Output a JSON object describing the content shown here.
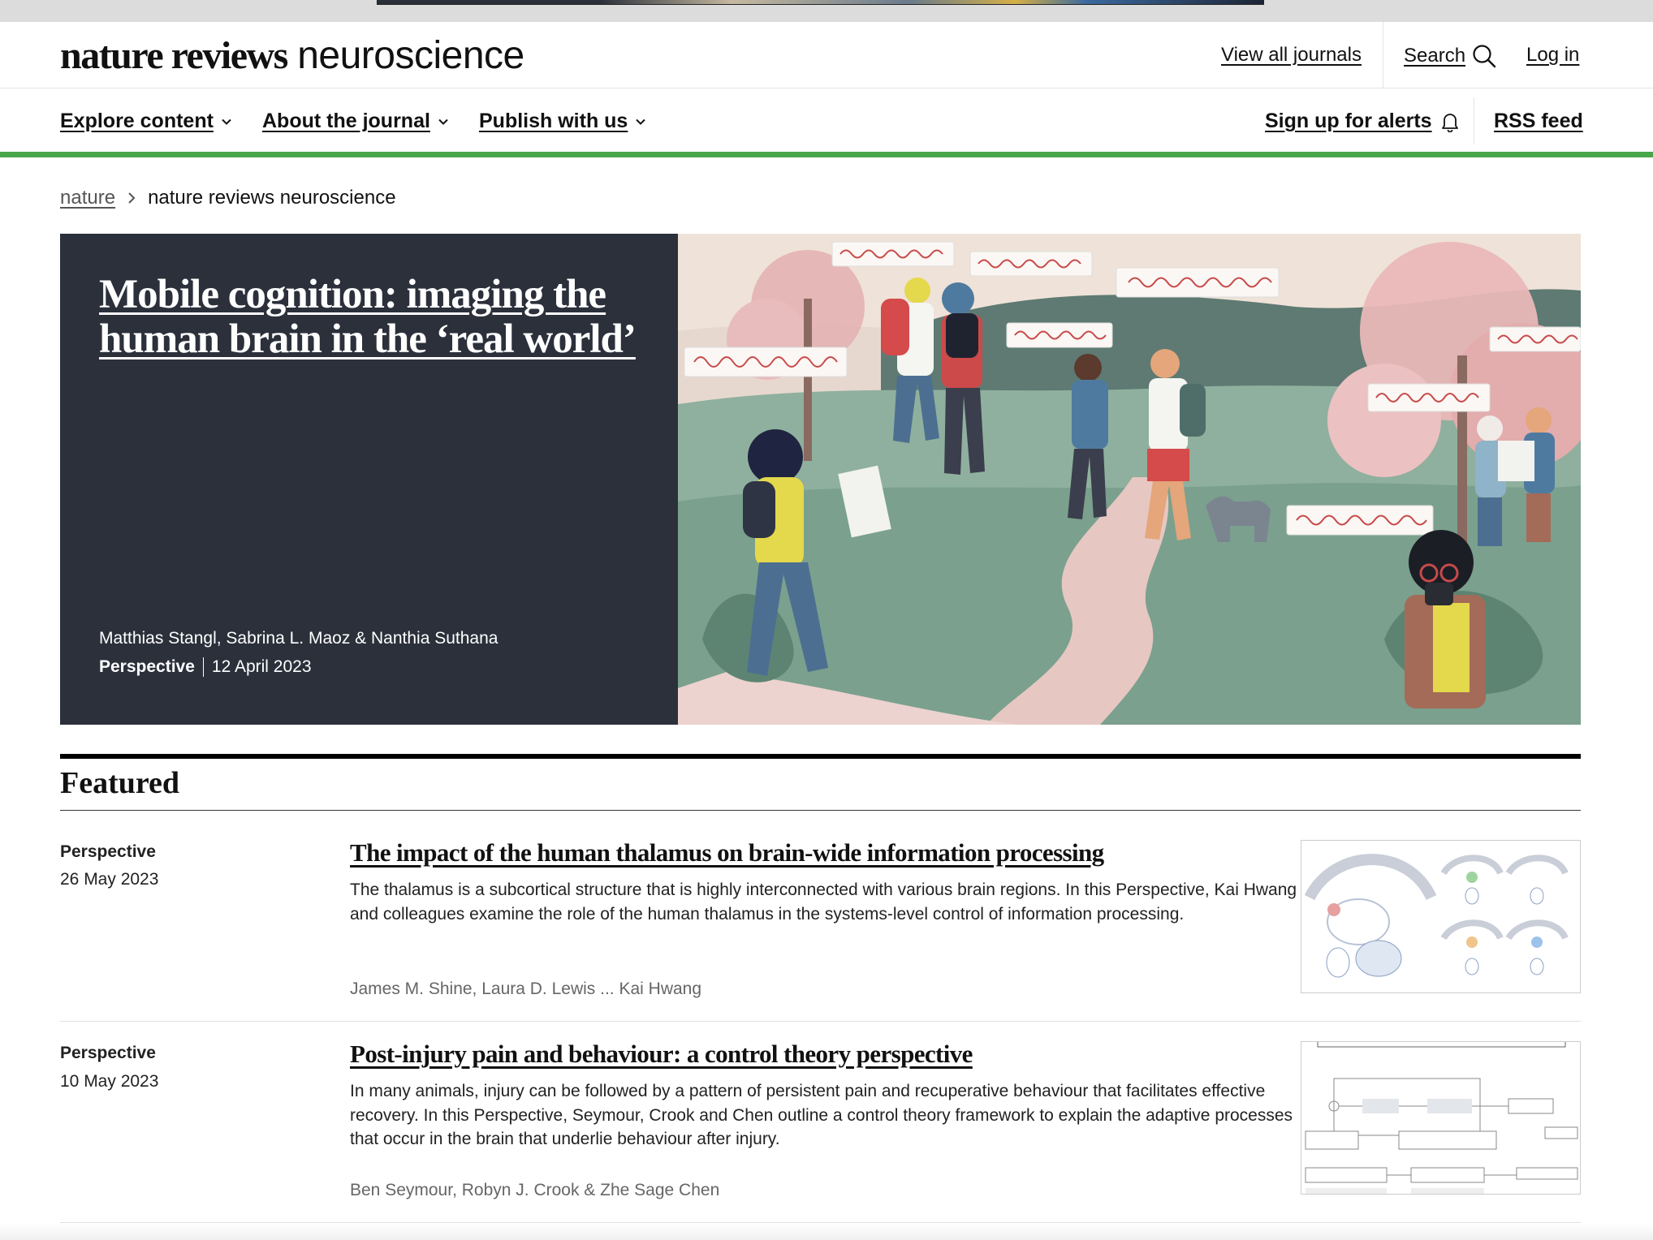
{
  "header": {
    "logo_bold": "nature reviews",
    "logo_light": "neuroscience",
    "view_all_journals": "View all journals",
    "search": "Search",
    "login": "Log in"
  },
  "nav": {
    "explore": "Explore content",
    "about": "About the journal",
    "publish": "Publish with us",
    "alerts": "Sign up for alerts",
    "rss": "RSS feed"
  },
  "breadcrumb": {
    "root": "nature",
    "current": "nature reviews neuroscience"
  },
  "hero": {
    "title": "Mobile cognition: imaging the human brain in the ‘real world’",
    "authors": "Matthias Stangl, Sabrina L. Maoz & Nanthia Suthana",
    "type": "Perspective",
    "date": "12 April 2023"
  },
  "featured": {
    "heading": "Featured",
    "articles": [
      {
        "type": "Perspective",
        "date": "26 May 2023",
        "title": "The impact of the human thalamus on brain-wide information processing",
        "summary": "The thalamus is a subcortical structure that is highly interconnected with various brain regions. In this Perspective, Kai Hwang and colleagues examine the role of the human thalamus in the systems-level control of information processing.",
        "authors": "James M. Shine, Laura D. Lewis ... Kai Hwang"
      },
      {
        "type": "Perspective",
        "date": "10 May 2023",
        "title": "Post-injury pain and behaviour: a control theory perspective",
        "summary": "In many animals, injury can be followed by a pattern of persistent pain and recuperative behaviour that facilitates effective recovery. In this Perspective, Seymour, Crook and Chen outline a control theory framework to explain the adaptive processes that occur in the brain that underlie behaviour after injury.",
        "authors": "Ben Seymour, Robyn J. Crook & Zhe Sage Chen"
      }
    ]
  },
  "colors": {
    "accent_green": "#4aa64a",
    "hero_panel": "#2b303b"
  }
}
